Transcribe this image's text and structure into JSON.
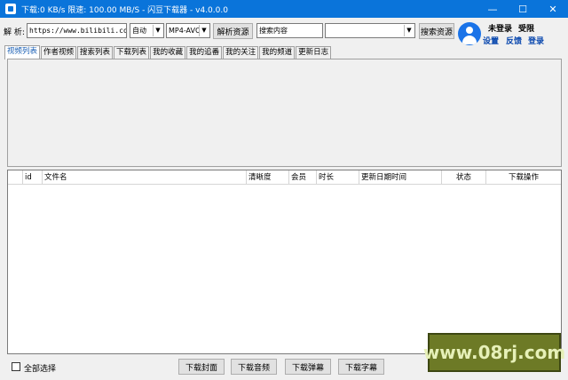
{
  "titlebar": {
    "title": "下载:0 KB/s  限速: 100.00 MB/S  - 闪豆下载器 - v4.0.0.0",
    "minimize": "—",
    "maximize": "☐",
    "close": "✕"
  },
  "toolbar": {
    "parse_label": "解 析:",
    "url_value": "https://www.bilibili.com/v",
    "quality_value": "自动",
    "format_value": "MP4-AVC",
    "parse_button": "解析资源",
    "search_value": "搜索内容",
    "search_type_value": "",
    "search_button": "搜索资源"
  },
  "user": {
    "login_status": "未登录",
    "privilege": "受限",
    "settings": "设置",
    "feedback": "反馈",
    "login": "登录"
  },
  "tabs": [
    {
      "label": "视频列表",
      "active": true
    },
    {
      "label": "作者视频"
    },
    {
      "label": "搜索列表"
    },
    {
      "label": "下载列表"
    },
    {
      "label": "我的收藏"
    },
    {
      "label": "我的追番"
    },
    {
      "label": "我的关注"
    },
    {
      "label": "我的频道"
    },
    {
      "label": "更新日志"
    }
  ],
  "table": {
    "columns": [
      "",
      "id",
      "文件名",
      "清晰度",
      "会员",
      "时长",
      "更新日期时间",
      "状态",
      "下载操作"
    ]
  },
  "bottom": {
    "select_all": "全部选择",
    "download_cover": "下载封面",
    "download_audio": "下载音频",
    "download_danmaku": "下载弹幕",
    "download_subtitle": "下载字幕"
  },
  "watermark": "www.08rj.com"
}
